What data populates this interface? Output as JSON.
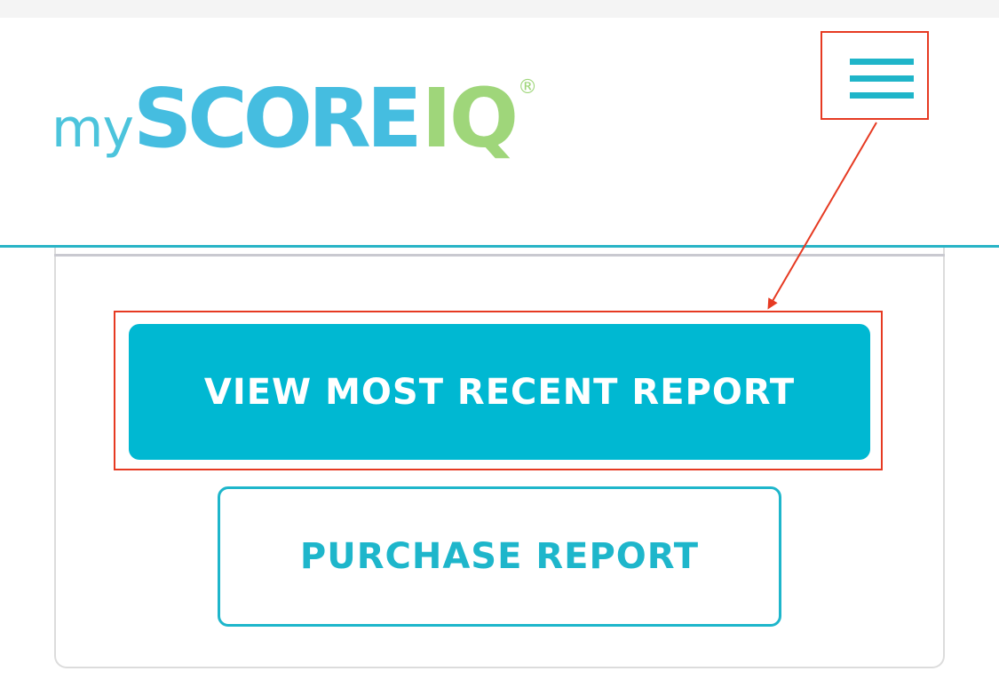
{
  "header": {
    "logo": {
      "my": "my",
      "score": "SCORE",
      "iq": "IQ",
      "registered": "®"
    },
    "menu_icon": "hamburger-menu-icon"
  },
  "actions": {
    "primary_label": "VIEW MOST RECENT REPORT",
    "secondary_label": "PURCHASE REPORT"
  },
  "colors": {
    "brand_blue": "#45bde0",
    "brand_green": "#9fd67a",
    "accent_teal": "#00b8d2",
    "annotation_red": "#e63a22"
  }
}
